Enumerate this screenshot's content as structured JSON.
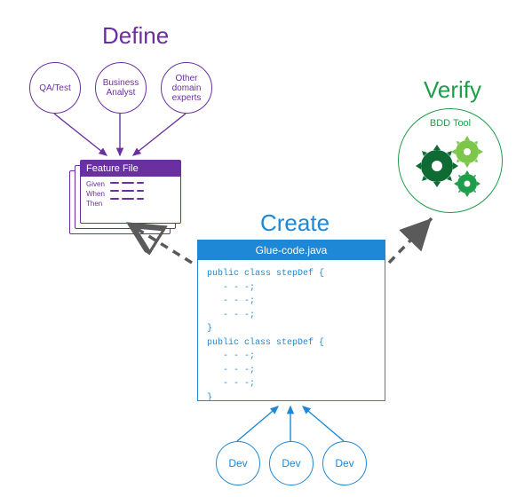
{
  "define": {
    "title": "Define",
    "roles": [
      "QA/Test",
      "Business\nAnalyst",
      "Other\ndomain\nexperts"
    ],
    "feature_file": {
      "header": "Feature File",
      "keywords": [
        "Given",
        "When",
        "Then"
      ]
    }
  },
  "create": {
    "title": "Create",
    "file_name": "Glue-code.java",
    "code": "public class stepDef {\n   - - -;\n   - - -;\n   - - -;\n}\npublic class stepDef {\n   - - -;\n   - - -;\n   - - -;\n}",
    "devs": [
      "Dev",
      "Dev",
      "Dev"
    ]
  },
  "verify": {
    "title": "Verify",
    "tool_label": "BDD Tool"
  }
}
